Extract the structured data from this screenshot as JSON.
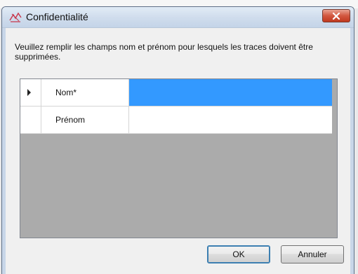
{
  "window": {
    "title": "Confidentialité"
  },
  "dialog": {
    "instruction": "Veuillez remplir les champs nom et prénom pour lesquels les traces doivent être supprimées."
  },
  "grid": {
    "rows": [
      {
        "label": "Nom*",
        "value": "",
        "selected": true
      },
      {
        "label": "Prénom",
        "value": "",
        "selected": false
      }
    ]
  },
  "buttons": {
    "ok_label": "OK",
    "cancel_label": "Annuler"
  },
  "colors": {
    "selection": "#3399ff",
    "grid_background": "#ababab",
    "close_button": "#c0391f"
  },
  "icons": {
    "app": "privacy-icon",
    "close": "close-icon",
    "row_indicator": "row-pointer-icon"
  }
}
